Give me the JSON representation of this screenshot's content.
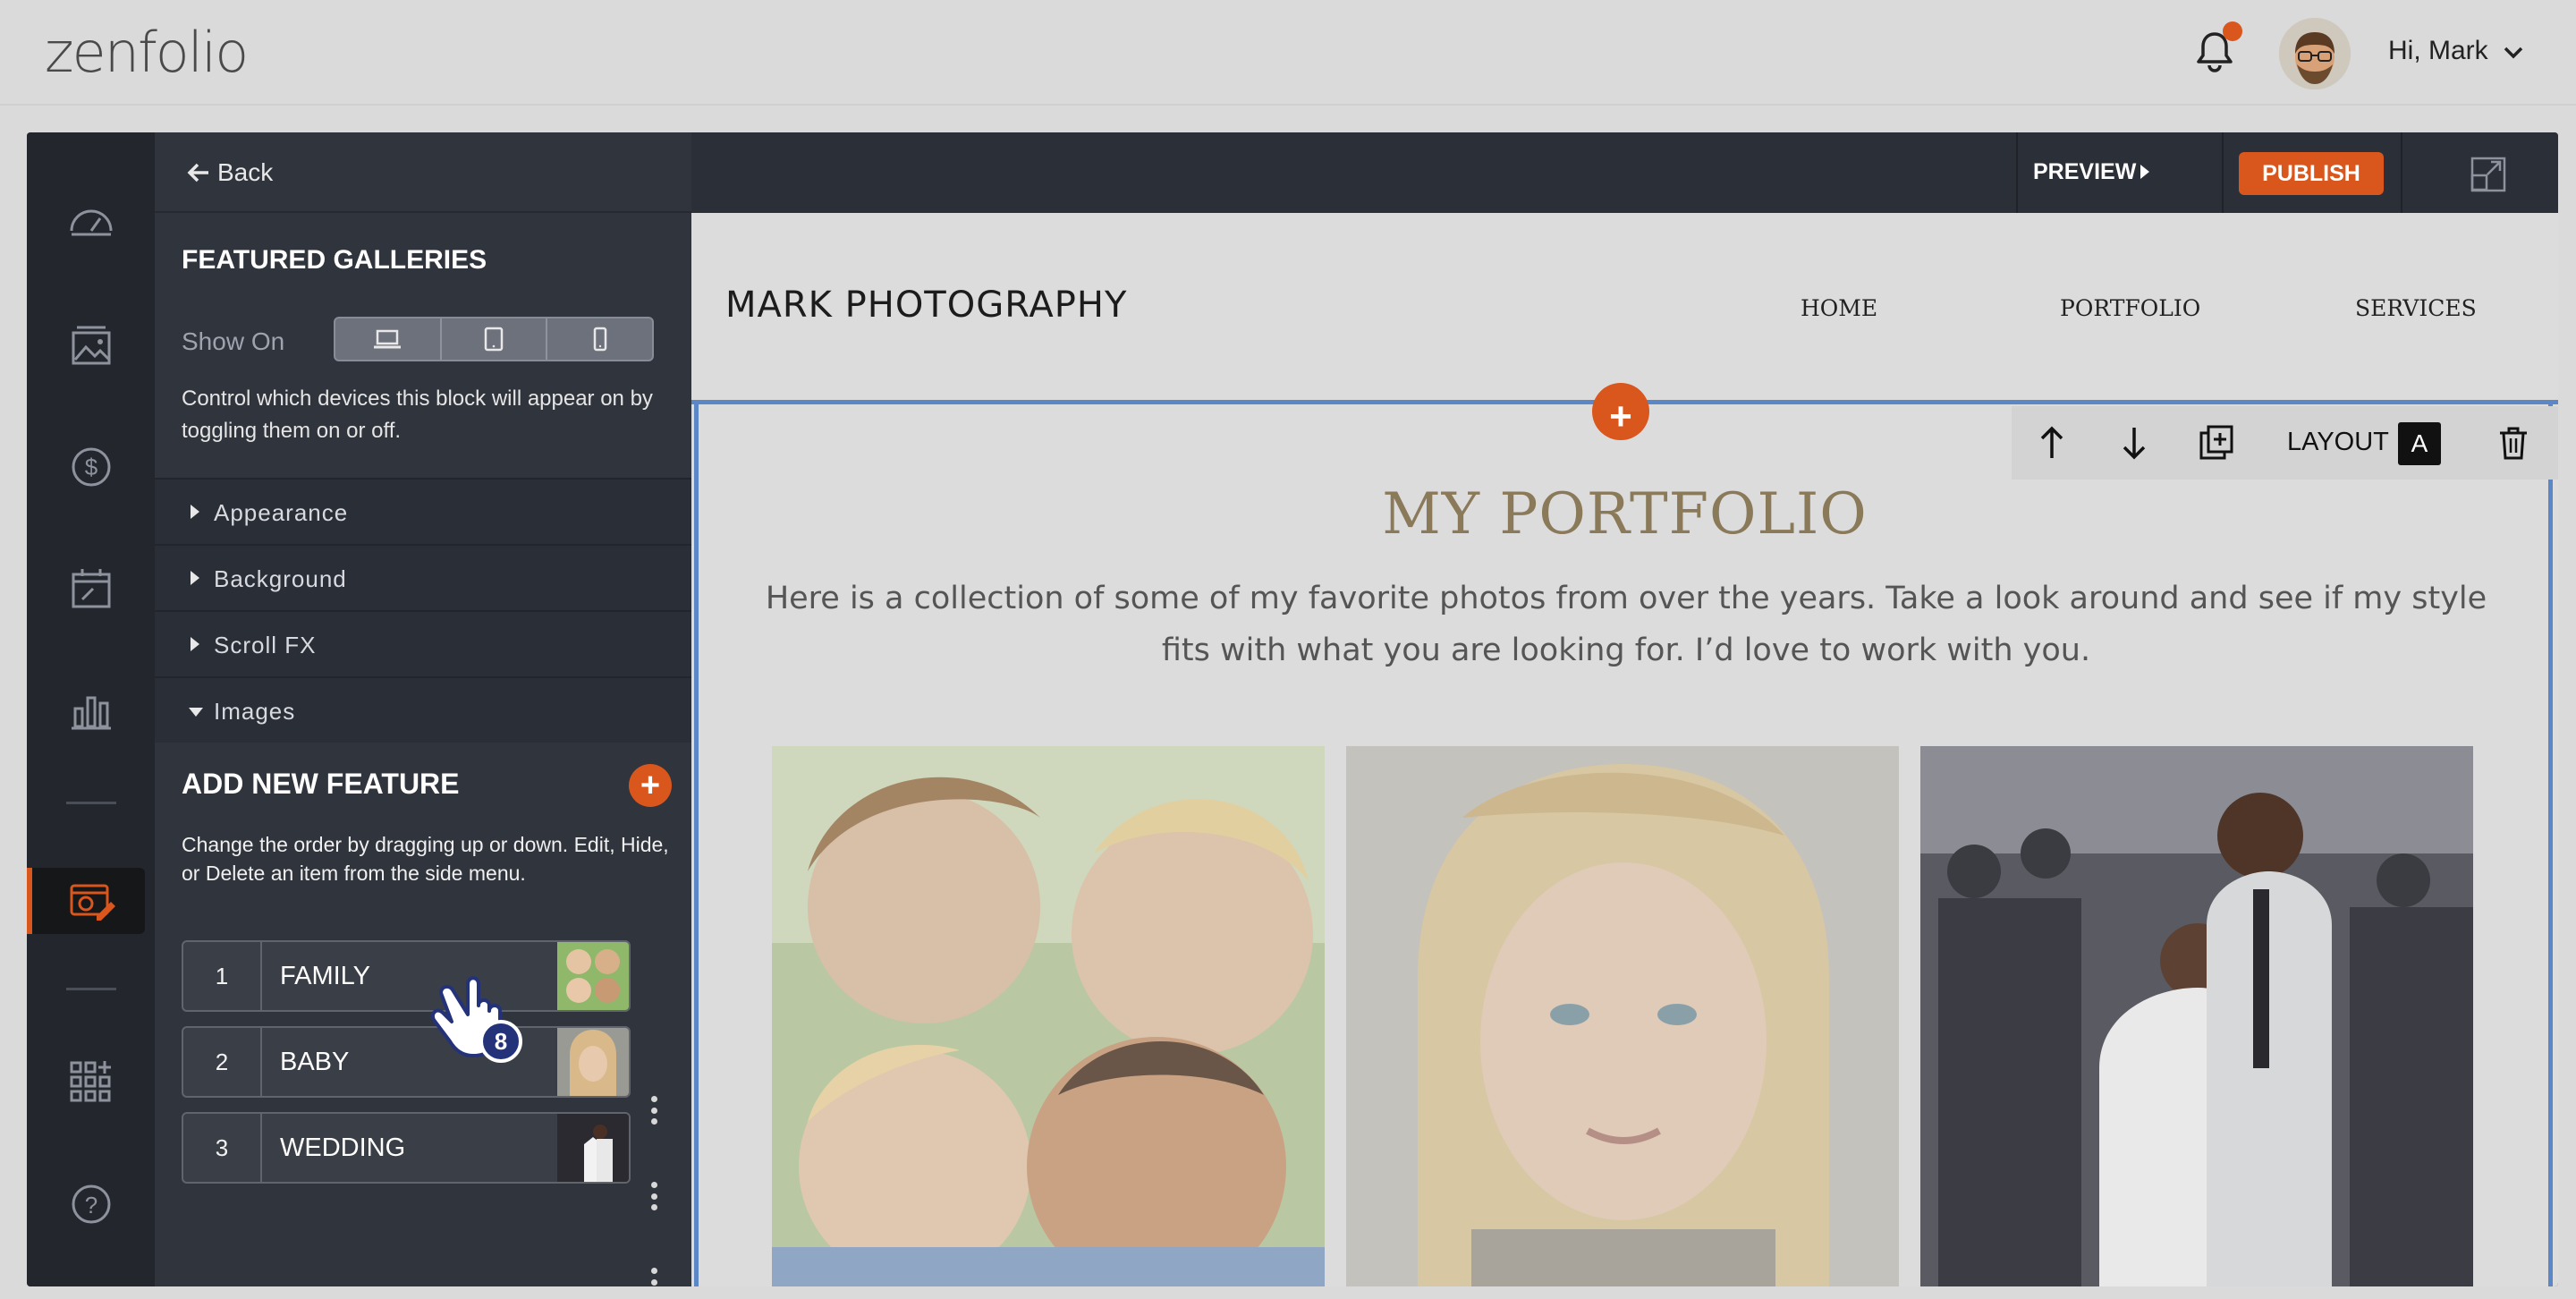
{
  "app": {
    "logo_text": "zenfolio",
    "greeting": "Hi, Mark"
  },
  "panel": {
    "back_label": "Back",
    "title": "FEATURED GALLERIES",
    "show_on_label": "Show On",
    "description": "Control which devices this block will appear on by toggling them on or off.",
    "sections": [
      {
        "label": "Appearance",
        "expanded": false
      },
      {
        "label": "Background",
        "expanded": false
      },
      {
        "label": "Scroll FX",
        "expanded": false
      },
      {
        "label": "Images",
        "expanded": true
      }
    ],
    "add_feature_title": "ADD NEW FEATURE",
    "add_feature_desc": "Change the order by dragging up or down. Edit, Hide, or Delete an item from the side menu.",
    "features": [
      {
        "num": "1",
        "name": "FAMILY"
      },
      {
        "num": "2",
        "name": "BABY"
      },
      {
        "num": "3",
        "name": "WEDDING"
      }
    ],
    "cursor_badge": "8"
  },
  "editor": {
    "preview_label": "PREVIEW",
    "publish_label": "PUBLISH"
  },
  "site": {
    "name": "MARK PHOTOGRAPHY",
    "nav": [
      "HOME",
      "PORTFOLIO",
      "SERVICES"
    ],
    "toolbar": {
      "layout_label": "LAYOUT",
      "layout_value": "A"
    },
    "section_title": "MY PORTFOLIO",
    "section_desc": "Here is a collection of some of my favorite photos from over the years. Take a look around and see if my style fits with what you are looking for. I’d love to work with you."
  },
  "colors": {
    "accent": "#d9561d",
    "selection": "#5b87c6",
    "rail_bg": "#23262d",
    "panel_bg": "#30343d"
  }
}
